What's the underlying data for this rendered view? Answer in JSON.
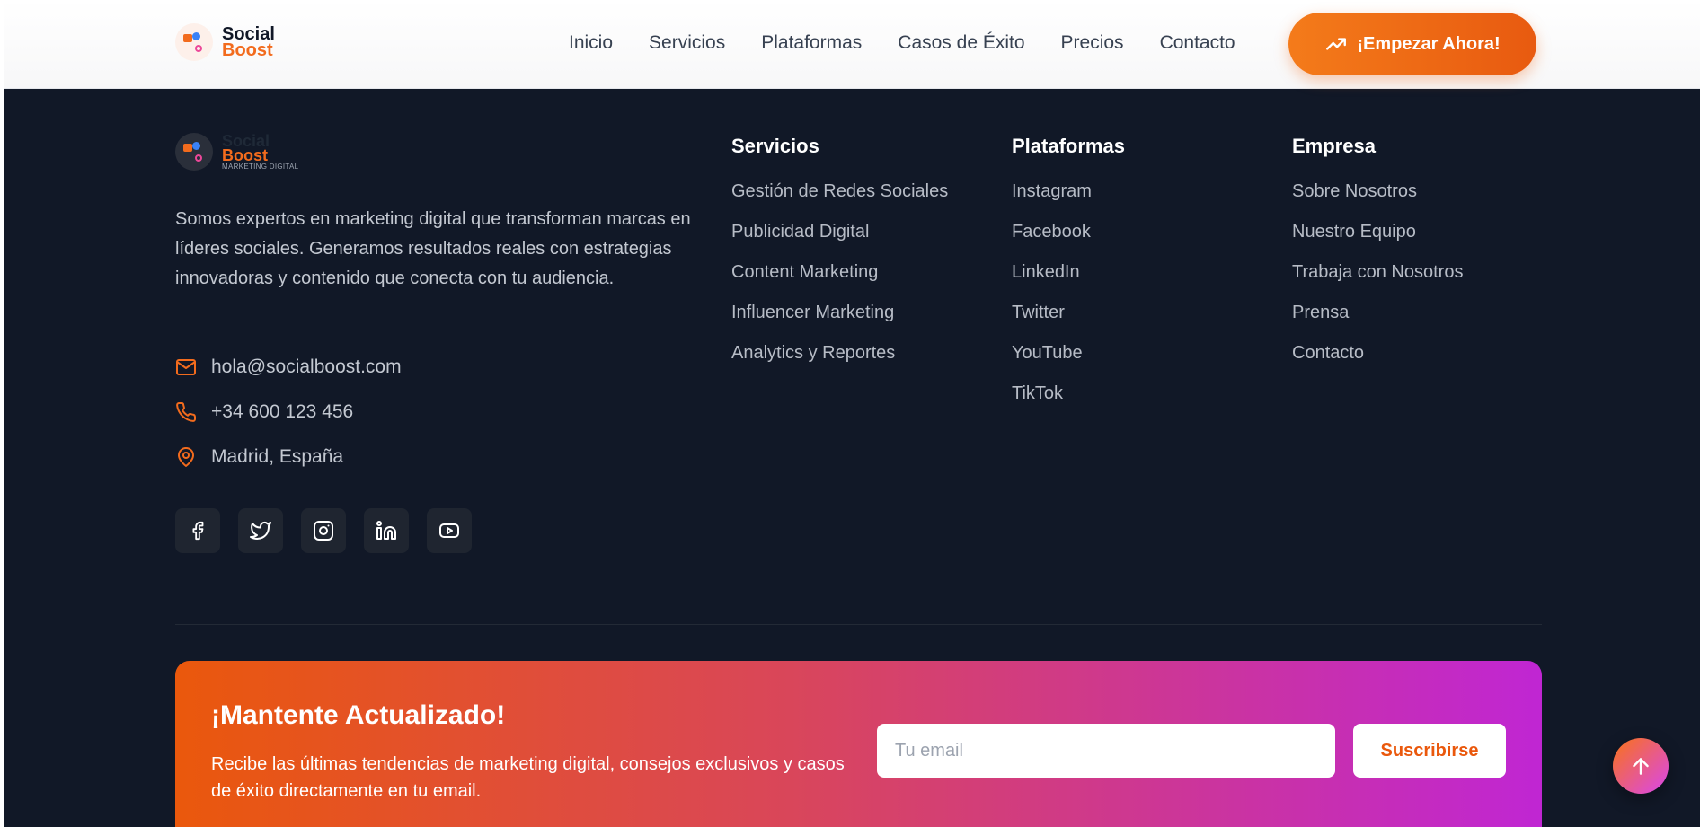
{
  "brand": {
    "line1": "Social",
    "line2": "Boost",
    "tagline": "MARKETING DIGITAL"
  },
  "nav": {
    "items": [
      "Inicio",
      "Servicios",
      "Plataformas",
      "Casos de Éxito",
      "Precios",
      "Contacto"
    ],
    "cta": "¡Empezar Ahora!"
  },
  "footer": {
    "description": "Somos expertos en marketing digital que transforman marcas en líderes sociales. Generamos resultados reales con estrategias innovadoras y contenido que conecta con tu audiencia.",
    "contact": {
      "email": "hola@socialboost.com",
      "phone": "+34 600 123 456",
      "location": "Madrid, España"
    },
    "socials": [
      "facebook-icon",
      "twitter-icon",
      "instagram-icon",
      "linkedin-icon",
      "youtube-icon"
    ],
    "columns": [
      {
        "title": "Servicios",
        "items": [
          "Gestión de Redes Sociales",
          "Publicidad Digital",
          "Content Marketing",
          "Influencer Marketing",
          "Analytics y Reportes"
        ]
      },
      {
        "title": "Plataformas",
        "items": [
          "Instagram",
          "Facebook",
          "LinkedIn",
          "Twitter",
          "YouTube",
          "TikTok"
        ]
      },
      {
        "title": "Empresa",
        "items": [
          "Sobre Nosotros",
          "Nuestro Equipo",
          "Trabaja con Nosotros",
          "Prensa",
          "Contacto"
        ]
      }
    ]
  },
  "newsletter": {
    "title": "¡Mantente Actualizado!",
    "text": "Recibe las últimas tendencias de marketing digital, consejos exclusivos y casos de éxito directamente en tu email.",
    "placeholder": "Tu email",
    "button": "Suscribirse"
  },
  "colors": {
    "accent": "#f26b1d",
    "background": "#111827",
    "gradient_end": "#c026d3"
  }
}
